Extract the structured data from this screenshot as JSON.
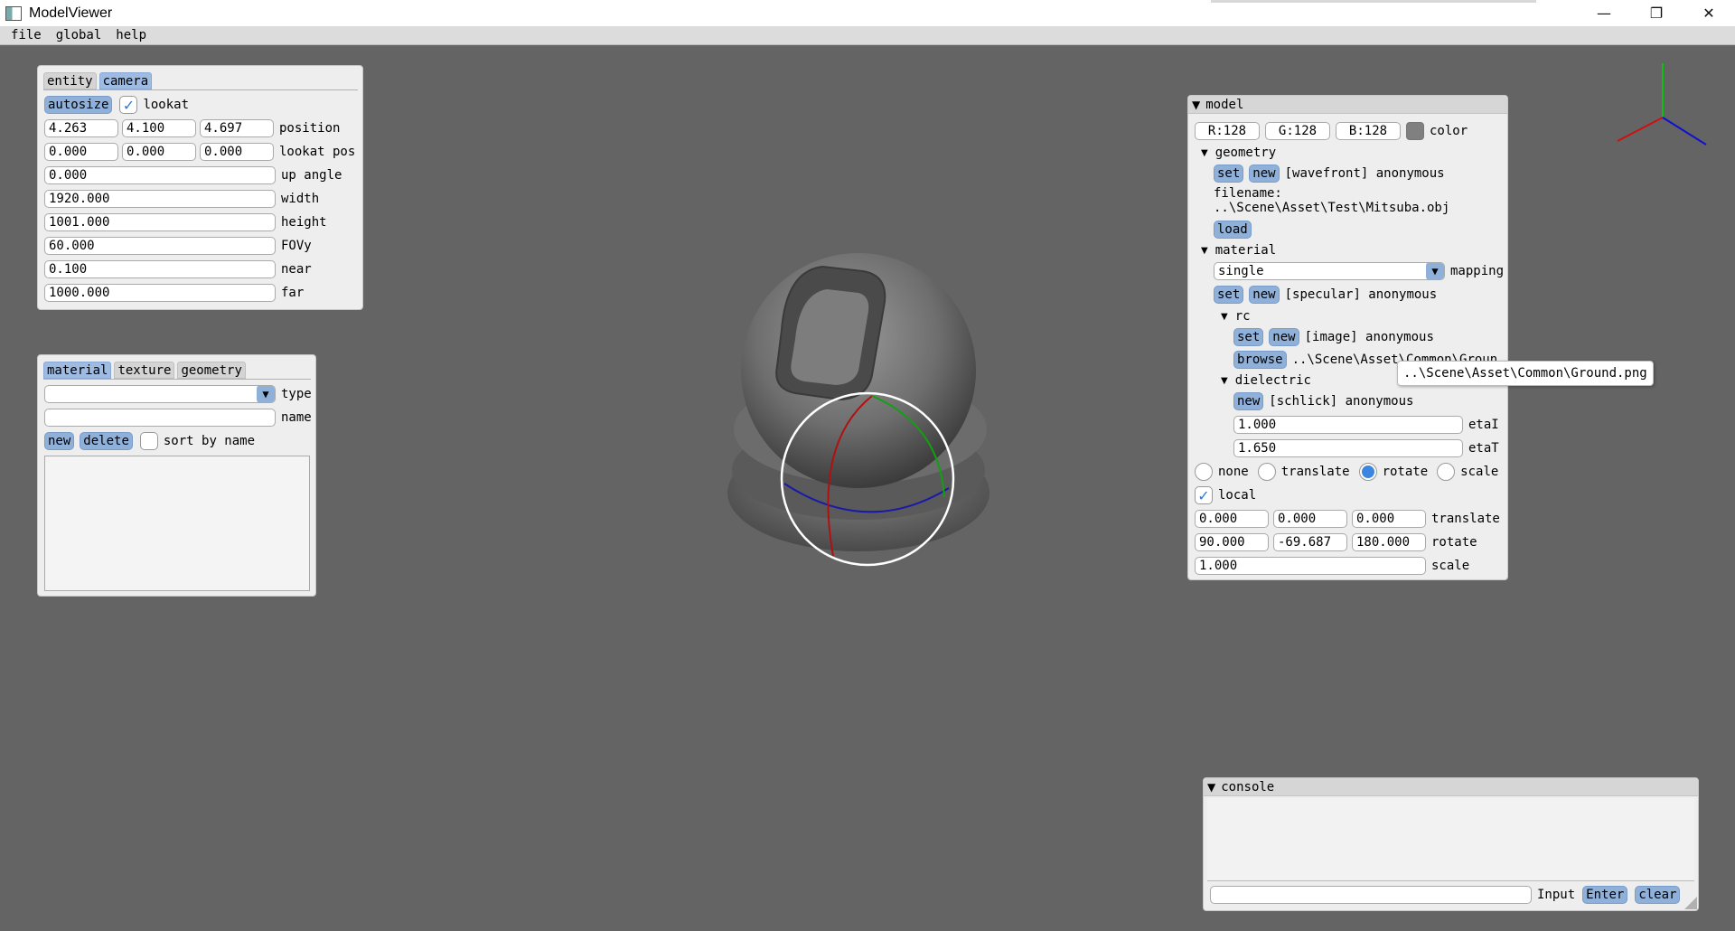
{
  "window": {
    "title": "ModelViewer",
    "min": "—",
    "max": "❐",
    "close": "✕"
  },
  "menu": [
    "file",
    "global",
    "help"
  ],
  "camera_panel": {
    "tabs": [
      "entity",
      "camera"
    ],
    "autosize": "autosize",
    "lookat_label": "lookat",
    "check_mark": "✓",
    "position": [
      "4.263",
      "4.100",
      "4.697"
    ],
    "position_label": "position",
    "lookat_pos": [
      "0.000",
      "0.000",
      "0.000"
    ],
    "lookat_pos_label": "lookat pos",
    "up_angle": "0.000",
    "up_angle_label": "up angle",
    "width": "1920.000",
    "width_label": "width",
    "height": "1001.000",
    "height_label": "height",
    "fovy": "60.000",
    "fovy_label": "FOVy",
    "near": "0.100",
    "near_label": "near",
    "far": "1000.000",
    "far_label": "far"
  },
  "resource_panel": {
    "tabs": [
      "material",
      "texture",
      "geometry"
    ],
    "type_label": "type",
    "name_label": "name",
    "new_btn": "new",
    "delete_btn": "delete",
    "sort_label": "sort by name",
    "arrow": "▼"
  },
  "model_panel": {
    "title": "model",
    "arrow_open": "▼",
    "tri_small": "▼",
    "color": {
      "r": "R:128",
      "g": "G:128",
      "b": "B:128",
      "label": "color",
      "swatch": "#808080"
    },
    "geometry": {
      "title": "geometry",
      "set": "set",
      "new": "new",
      "desc": "[wavefront] anonymous",
      "filename_label": "filename:",
      "filename": "..\\Scene\\Asset\\Test\\Mitsuba.obj",
      "load": "load"
    },
    "material": {
      "title": "material",
      "mapping_value": "single",
      "mapping_label": "mapping",
      "set": "set",
      "new": "new",
      "desc": "[specular] anonymous",
      "rc": {
        "title": "rc",
        "set": "set",
        "new": "new",
        "desc": "[image] anonymous",
        "browse": "browse",
        "path": "..\\Scene\\Asset\\Common\\Groun"
      },
      "dielectric": {
        "title": "dielectric",
        "new": "new",
        "desc": "[schlick] anonymous",
        "etaI": "1.000",
        "etaI_label": "etaI",
        "etaT": "1.650",
        "etaT_label": "etaT"
      }
    },
    "transform_modes": [
      "none",
      "translate",
      "rotate",
      "scale"
    ],
    "local_label": "local",
    "translate": [
      "0.000",
      "0.000",
      "0.000"
    ],
    "translate_label": "translate",
    "rotate": [
      "90.000",
      "-69.687",
      "180.000"
    ],
    "rotate_label": "rotate",
    "scale": "1.000",
    "scale_label": "scale"
  },
  "tooltip": "..\\Scene\\Asset\\Common\\Ground.png",
  "console": {
    "title": "console",
    "input_label": "Input",
    "enter": "Enter",
    "clear": "clear"
  }
}
